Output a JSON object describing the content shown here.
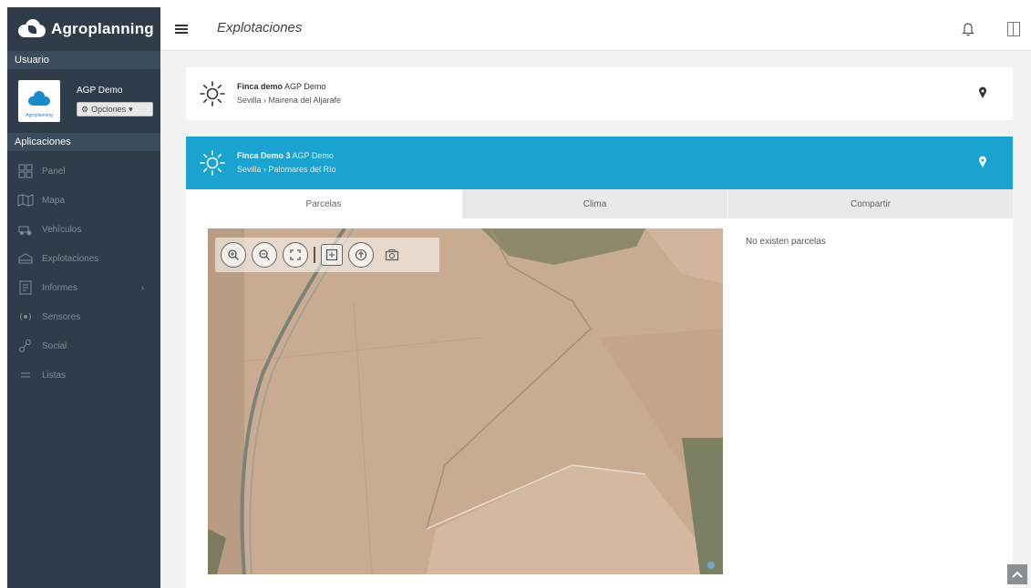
{
  "app": {
    "brand": "Agroplanning"
  },
  "header": {
    "page_title": "Explotaciones"
  },
  "sidebar": {
    "user_section_label": "Usuario",
    "user_name": "AGP Demo",
    "options_label": "Opciones",
    "avatar_caption": "Agroplanning",
    "apps_section_label": "Aplicaciones",
    "items": [
      {
        "label": "Panel",
        "icon": "grid-icon"
      },
      {
        "label": "Mapa",
        "icon": "map-icon"
      },
      {
        "label": "Vehículos",
        "icon": "vehicle-icon"
      },
      {
        "label": "Explotaciones",
        "icon": "farm-icon"
      },
      {
        "label": "Informes",
        "icon": "report-icon",
        "chevron": "›"
      },
      {
        "label": "Sensores",
        "icon": "sensor-icon"
      },
      {
        "label": "Social",
        "icon": "social-icon"
      },
      {
        "label": "Listas",
        "icon": "list-icon"
      }
    ]
  },
  "fincas": [
    {
      "name": "Finca demo",
      "owner": "AGP Demo",
      "location": "Sevilla › Mairena del Aljarafe",
      "active": false
    },
    {
      "name": "Finca Demo 3",
      "owner": "AGP Demo",
      "location": "Sevilla › Palomares del Río",
      "active": true
    }
  ],
  "tabs": [
    {
      "label": "Parcelas",
      "active": true
    },
    {
      "label": "Clima",
      "active": false
    },
    {
      "label": "Compartir",
      "active": false
    }
  ],
  "parcels_panel": {
    "empty_message": "No existen parcelas"
  },
  "colors": {
    "accent": "#1aa3d1",
    "sidebar_bg": "#2f3d4b"
  }
}
